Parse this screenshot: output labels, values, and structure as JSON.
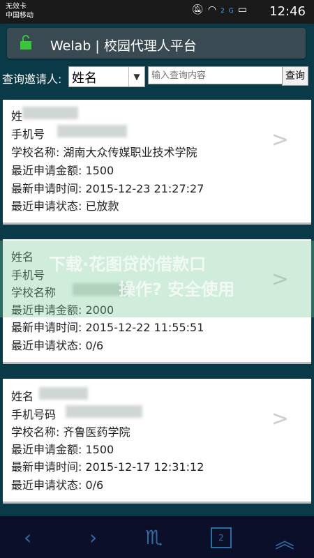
{
  "status_bar": {
    "carrier_line1": "无效卡",
    "carrier_line2": "中国移动",
    "network": "2G",
    "time": "12:46"
  },
  "header": {
    "title": "Welab | 校园代理人平台"
  },
  "query": {
    "label": "查询邀请人:",
    "select_value": "姓名",
    "input_placeholder": "输入查询内容",
    "search_button": "查询"
  },
  "cards": [
    {
      "name_label": "姓",
      "phone_label": "手机号",
      "school": "学校名称: 湖南大众传媒职业技术学院",
      "amount": "最近申请金额: 1500",
      "time": "最新申请时间: 2015-12-23 21:27:27",
      "status": "最近申请状态: 已放款"
    },
    {
      "name_label": "姓名",
      "phone_label": "手机号",
      "school": "学校名称",
      "amount": "最近申请金额: 2000",
      "time": "最新申请时间: 2015-12-22 11:55:51",
      "status": "最近申请状态: 0/6"
    },
    {
      "name_label": "姓名",
      "phone_label": "手机号码",
      "school": "学校名称: 齐鲁医药学院",
      "amount": "最近申请金额: 1500",
      "time": "最新申请时间: 2015-12-17 12:31:12",
      "status": "最近申请状态: 0/6"
    }
  ],
  "watermark": {
    "line1": "下载·花图贷的借款口",
    "line2": "操作? 安全使用"
  },
  "bottom_nav": {
    "page_number": "2"
  }
}
